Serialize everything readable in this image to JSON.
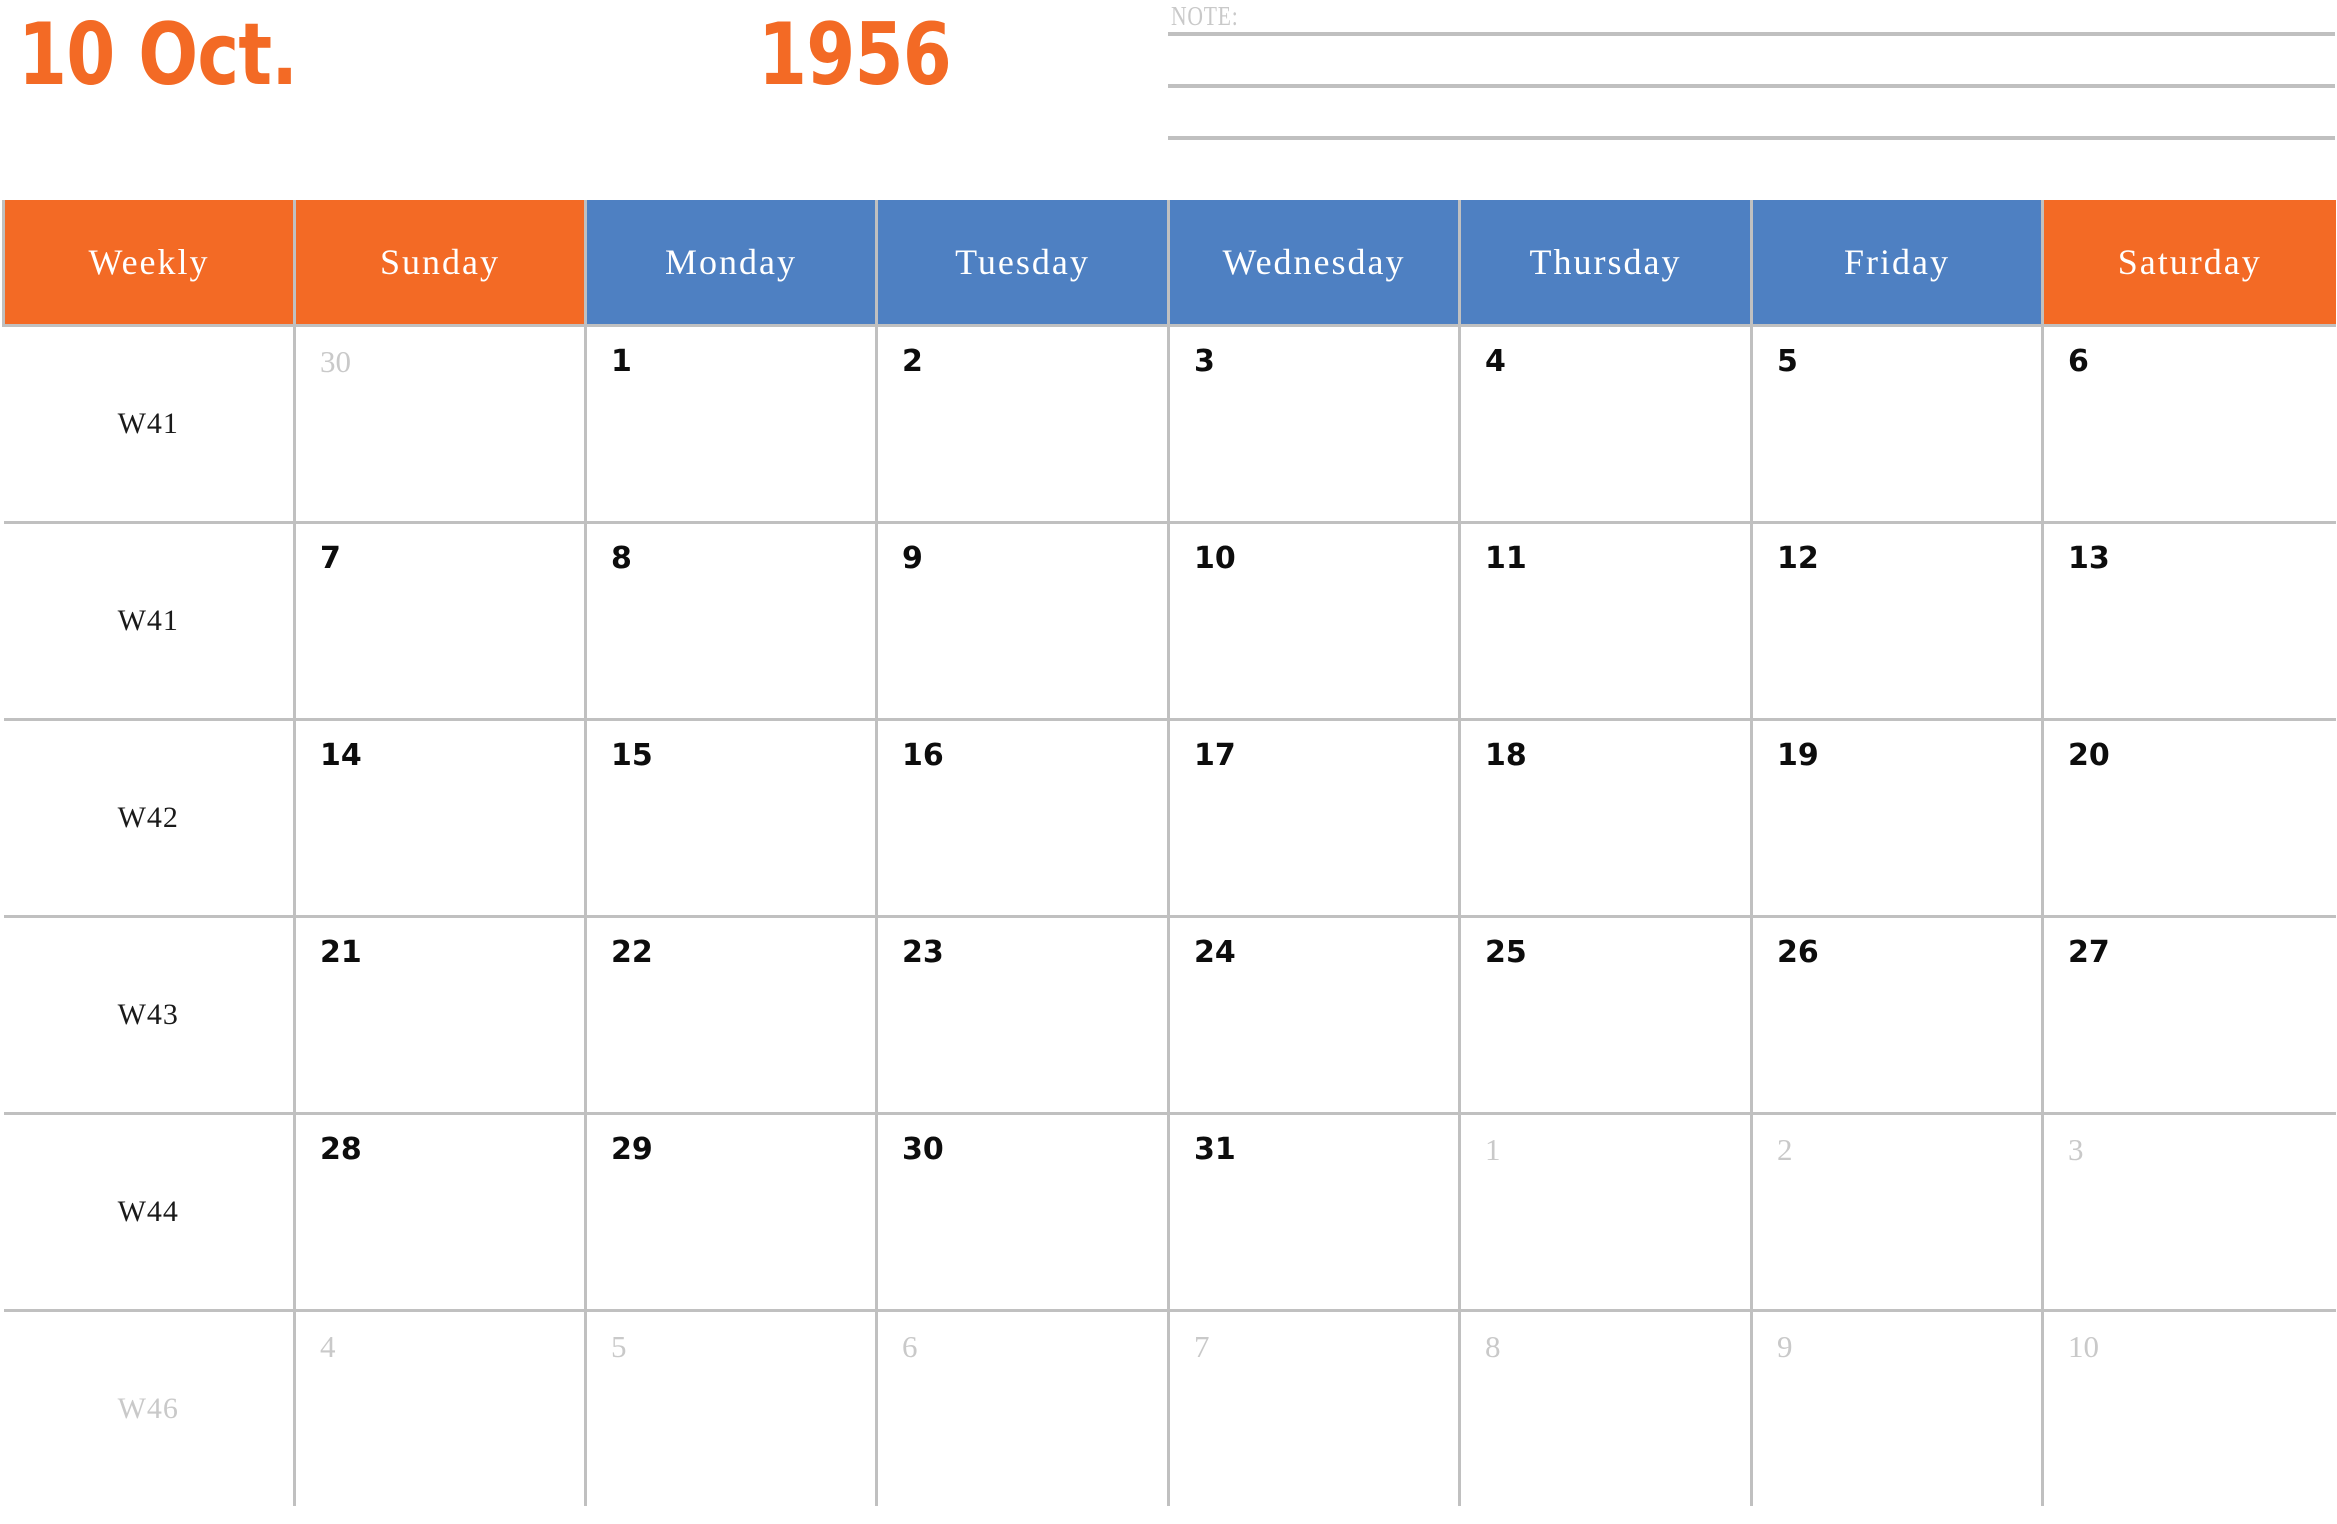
{
  "header": {
    "month_label": "10 Oct.",
    "year_label": "1956",
    "accent_color": "#f36a25",
    "weekday_color": "#4e80c2",
    "muted_color": "#c9c9c9",
    "grid_color": "#c0c0c0"
  },
  "note": {
    "label": "NOTE:",
    "line_count": 3
  },
  "columns": [
    {
      "label": "Weekly",
      "kind": "weekly"
    },
    {
      "label": "Sunday",
      "kind": "weekend"
    },
    {
      "label": "Monday",
      "kind": "weekday"
    },
    {
      "label": "Tuesday",
      "kind": "weekday"
    },
    {
      "label": "Wednesday",
      "kind": "weekday"
    },
    {
      "label": "Thursday",
      "kind": "weekday"
    },
    {
      "label": "Friday",
      "kind": "weekday"
    },
    {
      "label": "Saturday",
      "kind": "weekend"
    }
  ],
  "weeks": [
    {
      "week_label": "W41",
      "week_muted": false,
      "days": [
        {
          "num": "30",
          "muted": true
        },
        {
          "num": "1",
          "muted": false
        },
        {
          "num": "2",
          "muted": false
        },
        {
          "num": "3",
          "muted": false
        },
        {
          "num": "4",
          "muted": false
        },
        {
          "num": "5",
          "muted": false
        },
        {
          "num": "6",
          "muted": false
        }
      ]
    },
    {
      "week_label": "W41",
      "week_muted": false,
      "days": [
        {
          "num": "7",
          "muted": false
        },
        {
          "num": "8",
          "muted": false
        },
        {
          "num": "9",
          "muted": false
        },
        {
          "num": "10",
          "muted": false
        },
        {
          "num": "11",
          "muted": false
        },
        {
          "num": "12",
          "muted": false
        },
        {
          "num": "13",
          "muted": false
        }
      ]
    },
    {
      "week_label": "W42",
      "week_muted": false,
      "days": [
        {
          "num": "14",
          "muted": false
        },
        {
          "num": "15",
          "muted": false
        },
        {
          "num": "16",
          "muted": false
        },
        {
          "num": "17",
          "muted": false
        },
        {
          "num": "18",
          "muted": false
        },
        {
          "num": "19",
          "muted": false
        },
        {
          "num": "20",
          "muted": false
        }
      ]
    },
    {
      "week_label": "W43",
      "week_muted": false,
      "days": [
        {
          "num": "21",
          "muted": false
        },
        {
          "num": "22",
          "muted": false
        },
        {
          "num": "23",
          "muted": false
        },
        {
          "num": "24",
          "muted": false
        },
        {
          "num": "25",
          "muted": false
        },
        {
          "num": "26",
          "muted": false
        },
        {
          "num": "27",
          "muted": false
        }
      ]
    },
    {
      "week_label": "W44",
      "week_muted": false,
      "days": [
        {
          "num": "28",
          "muted": false
        },
        {
          "num": "29",
          "muted": false
        },
        {
          "num": "30",
          "muted": false
        },
        {
          "num": "31",
          "muted": false
        },
        {
          "num": "1",
          "muted": true
        },
        {
          "num": "2",
          "muted": true
        },
        {
          "num": "3",
          "muted": true
        }
      ]
    },
    {
      "week_label": "W46",
      "week_muted": true,
      "days": [
        {
          "num": "4",
          "muted": true
        },
        {
          "num": "5",
          "muted": true
        },
        {
          "num": "6",
          "muted": true
        },
        {
          "num": "7",
          "muted": true
        },
        {
          "num": "8",
          "muted": true
        },
        {
          "num": "9",
          "muted": true
        },
        {
          "num": "10",
          "muted": true
        }
      ]
    }
  ]
}
